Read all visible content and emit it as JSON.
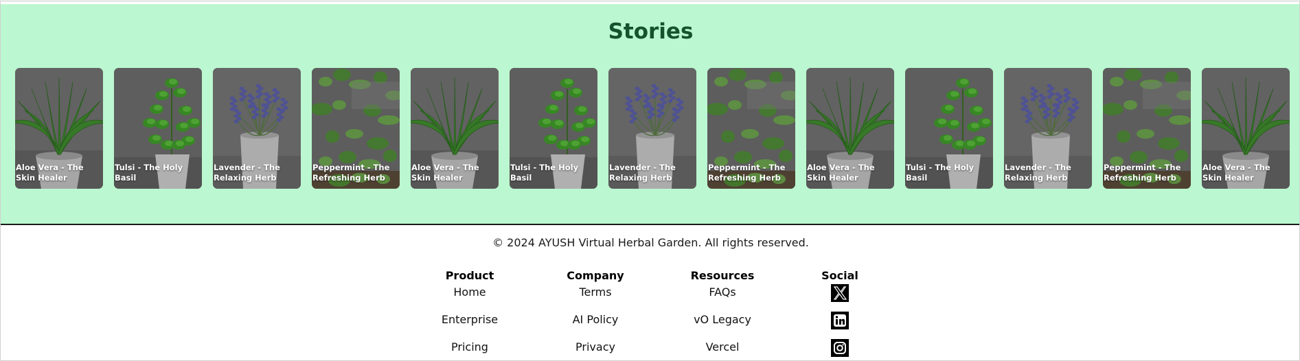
{
  "stories": {
    "title": "Stories",
    "cards": [
      {
        "caption": "Aloe Vera - The Skin Healer",
        "plant": "aloe"
      },
      {
        "caption": "Tulsi - The Holy Basil",
        "plant": "tulsi"
      },
      {
        "caption": "Lavender - The Relaxing Herb",
        "plant": "lavender"
      },
      {
        "caption": "Peppermint - The Refreshing Herb",
        "plant": "peppermint"
      },
      {
        "caption": "Aloe Vera - The Skin Healer",
        "plant": "aloe"
      },
      {
        "caption": "Tulsi - The Holy Basil",
        "plant": "tulsi"
      },
      {
        "caption": "Lavender - The Relaxing Herb",
        "plant": "lavender"
      },
      {
        "caption": "Peppermint - The Refreshing Herb",
        "plant": "peppermint"
      },
      {
        "caption": "Aloe Vera - The Skin Healer",
        "plant": "aloe"
      },
      {
        "caption": "Tulsi - The Holy Basil",
        "plant": "tulsi"
      },
      {
        "caption": "Lavender - The Relaxing Herb",
        "plant": "lavender"
      },
      {
        "caption": "Peppermint - The Refreshing Herb",
        "plant": "peppermint"
      },
      {
        "caption": "Aloe Vera - The Skin Healer",
        "plant": "aloe"
      }
    ]
  },
  "footer": {
    "copyright": "© 2024 AYUSH Virtual Herbal Garden. All rights reserved.",
    "columns": [
      {
        "heading": "Product",
        "links": [
          "Home",
          "Enterprise",
          "Pricing"
        ]
      },
      {
        "heading": "Company",
        "links": [
          "Terms",
          "AI Policy",
          "Privacy"
        ]
      },
      {
        "heading": "Resources",
        "links": [
          "FAQs",
          "vO Legacy",
          "Vercel"
        ]
      }
    ],
    "social": {
      "heading": "Social",
      "icons": [
        "x-icon",
        "linkedin-icon",
        "instagram-icon"
      ]
    }
  },
  "colors": {
    "stories_bg": "#bbf7d0",
    "title_green": "#14532d"
  }
}
